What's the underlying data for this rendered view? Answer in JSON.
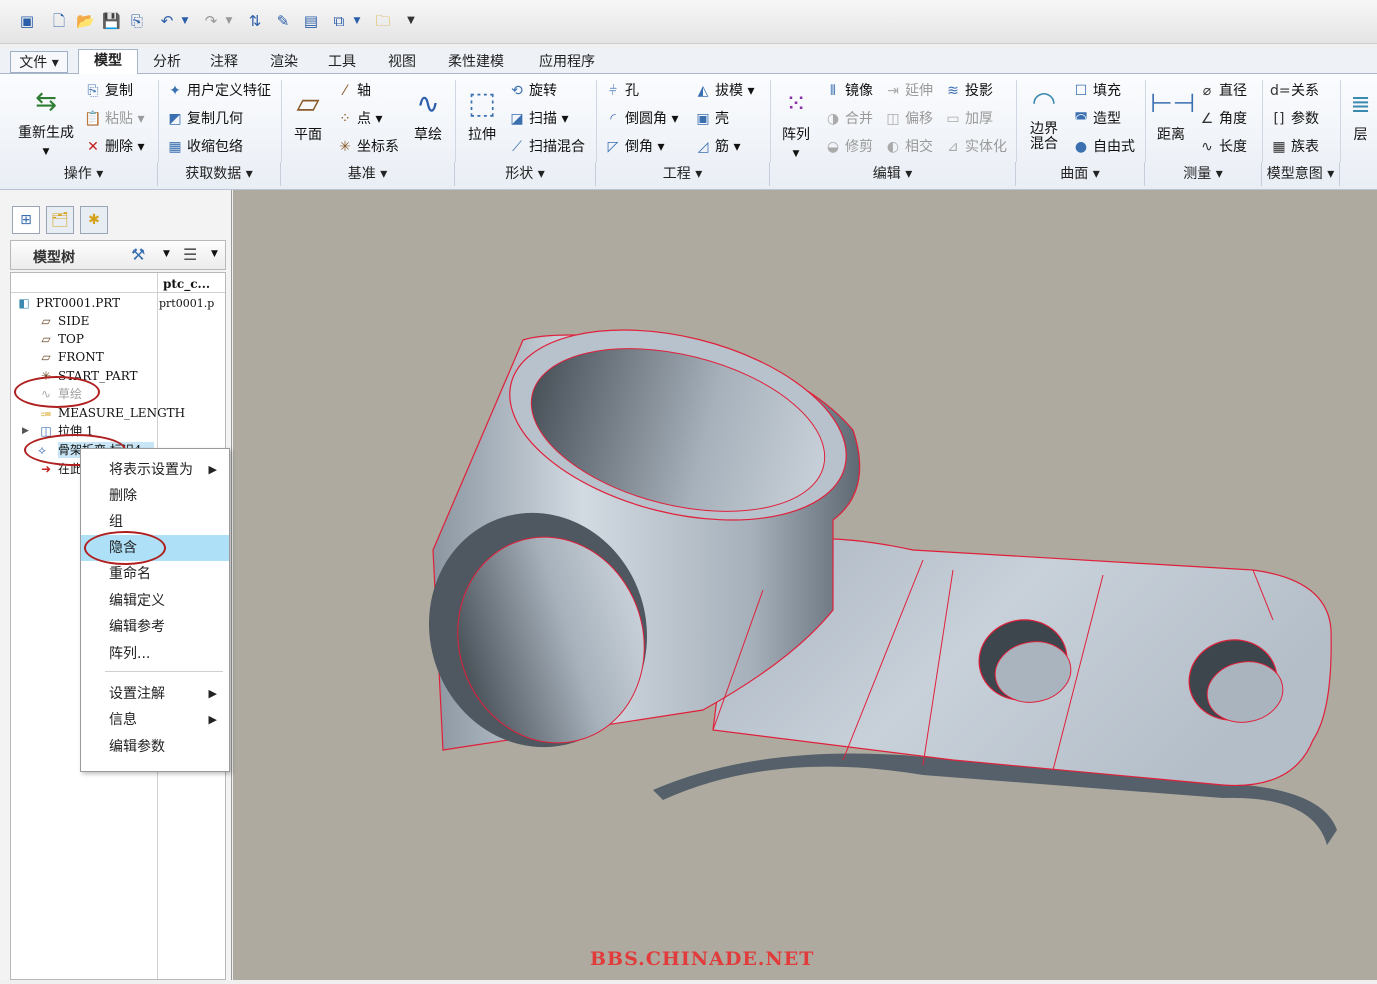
{
  "ribbon_tabs": [
    "文件",
    "模型",
    "分析",
    "注释",
    "渲染",
    "工具",
    "视图",
    "柔性建模",
    "应用程序"
  ],
  "groups": [
    "操作",
    "获取数据",
    "基准",
    "形状",
    "工程",
    "编辑",
    "曲面",
    "测量",
    "模型意图"
  ],
  "ops": {
    "regen": "重新生成",
    "copy": "复制",
    "paste": "粘贴",
    "delete": "删除"
  },
  "getdata": {
    "udf": "用户定义特征",
    "copygeom": "复制几何",
    "shrink": "收缩包络"
  },
  "datum": {
    "plane": "平面",
    "axis": "轴",
    "point": "点",
    "csys": "坐标系",
    "sketch": "草绘"
  },
  "shape": {
    "extrude": "拉伸",
    "revolve": "旋转",
    "sweep": "扫描",
    "sweepblend": "扫描混合"
  },
  "eng": {
    "hole": "孔",
    "round": "倒圆角",
    "chamfer": "倒角",
    "draft": "拔模",
    "shell": "壳",
    "rib": "筋"
  },
  "edit": {
    "pattern": "阵列",
    "mirror": "镜像",
    "merge": "合并",
    "trim": "修剪",
    "extend": "延伸",
    "offset": "偏移",
    "intersect": "相交",
    "project": "投影",
    "thicken": "加厚",
    "solidify": "实体化"
  },
  "surface": {
    "boundary": "边界\n混合",
    "fill": "填充",
    "style": "造型",
    "freeform": "自由式"
  },
  "measure": {
    "distance": "距离",
    "diameter": "直径",
    "angle": "角度",
    "length": "长度"
  },
  "intent": {
    "relations": "关系",
    "params": "参数",
    "family": "族表",
    "layer": "层"
  },
  "tree": {
    "title": "模型树",
    "col2": "ptc_c...",
    "col2_val": "prt0001.p",
    "rows": [
      "PRT0001.PRT",
      "SIDE",
      "TOP",
      "FRONT",
      "START_PART",
      "草绘",
      "MEASURE_LENGTH",
      "拉伸 1",
      "骨架折弯 标识4",
      "在此插入"
    ]
  },
  "context_menu": {
    "items": [
      "将表示设置为",
      "删除",
      "组",
      "隐含",
      "重命名",
      "编辑定义",
      "编辑参考",
      "阵列...",
      "设置注解",
      "信息",
      "编辑参数"
    ]
  },
  "watermark": "BBS.CHINADE.NET",
  "colors": {
    "highlight": "#aee0f7",
    "edge": "#e0203a",
    "part": "#b9c4cf",
    "bg": "#aeaaa0"
  }
}
